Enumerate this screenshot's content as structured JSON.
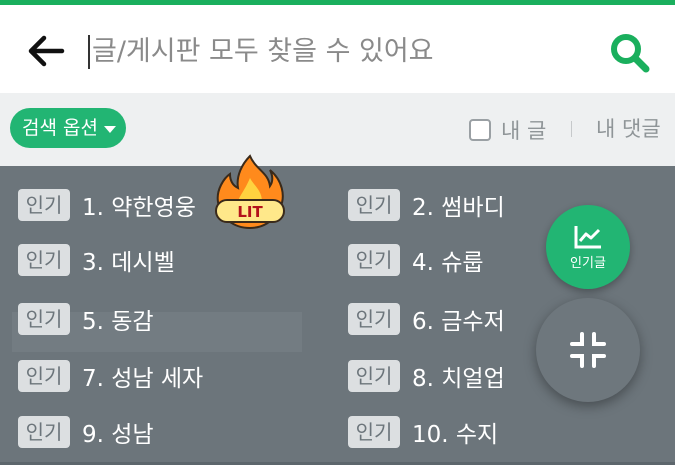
{
  "search": {
    "placeholder": "글/게시판 모두 찾을 수 있어요"
  },
  "options": {
    "search_options_label": "검색 옵션",
    "my_post_label": "내 글",
    "my_post_checked": false,
    "my_comment_label": "내 댓글"
  },
  "popular": {
    "badge": "인기",
    "items": [
      {
        "label": "1. 약한영웅"
      },
      {
        "label": "2. 썸바디"
      },
      {
        "label": "3. 데시벨"
      },
      {
        "label": "4. 슈룹"
      },
      {
        "label": "5. 동감"
      },
      {
        "label": "6. 금수저"
      },
      {
        "label": "7. 성남 세자"
      },
      {
        "label": "8. 치얼업"
      },
      {
        "label": "9. 성남"
      },
      {
        "label": "10. 수지"
      }
    ],
    "hot_sticker": "LIT"
  },
  "fab": {
    "popular_label": "인기글"
  },
  "colors": {
    "accent": "#22b573",
    "panel": "#6c757b",
    "badge_bg": "#dcdfe1"
  },
  "icons": [
    "back-arrow-icon",
    "search-icon",
    "caret-down-icon",
    "chart-icon",
    "collapse-icon",
    "fire-icon"
  ]
}
